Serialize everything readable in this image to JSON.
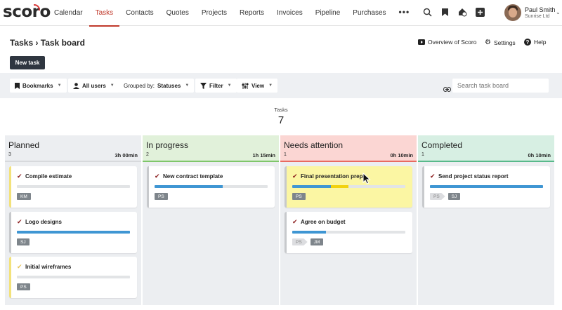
{
  "app": {
    "logo": "scoro",
    "nav": [
      "Calendar",
      "Tasks",
      "Contacts",
      "Quotes",
      "Projects",
      "Reports",
      "Invoices",
      "Pipeline",
      "Purchases"
    ],
    "nav_active": "Tasks",
    "more": "•••",
    "user": {
      "name": "Paul Smith",
      "company": "Sunrise Ltd"
    }
  },
  "header": {
    "breadcrumb": "Tasks › Task board",
    "overview_link": "Overview of Scoro",
    "settings_link": "Settings",
    "help_link": "Help",
    "new_task": "New task"
  },
  "toolbar": {
    "bookmarks": "Bookmarks",
    "users": "All users",
    "grouped_prefix": "Grouped by:",
    "grouped_value": "Statuses",
    "filter": "Filter",
    "view": "View",
    "search_placeholder": "Search task board"
  },
  "summary": {
    "label": "Tasks",
    "count": "7"
  },
  "columns": [
    {
      "title": "Planned",
      "count": "3",
      "time": "3h 00min",
      "head_color": "#eceef1",
      "underline": "#d7d9dc",
      "cards": [
        {
          "title": "Compile estimate",
          "check_color": "#8b1c1c",
          "accent": "#f3e27a",
          "bg": "#ffffff",
          "progress": [
            {
              "color": "#e2e4e6",
              "width": 0
            }
          ],
          "tags": [
            {
              "label": "KM",
              "ghost": false
            }
          ]
        },
        {
          "title": "Logo designs",
          "check_color": "#8b1c1c",
          "accent": "#c7c9cc",
          "bg": "#ffffff",
          "progress": [
            {
              "color": "#3f96d3",
              "width": 1.0
            }
          ],
          "tags": [
            {
              "label": "SJ",
              "ghost": false
            }
          ]
        },
        {
          "title": "Initial wireframes",
          "check_color": "#e6c35a",
          "accent": "#f3e27a",
          "bg": "#ffffff",
          "progress": [
            {
              "color": "#e2e4e6",
              "width": 0
            }
          ],
          "tags": [
            {
              "label": "PS",
              "ghost": false
            }
          ]
        }
      ]
    },
    {
      "title": "In progress",
      "count": "2",
      "time": "1h 15min",
      "head_color": "#e1f1da",
      "underline": "#7fc66a",
      "cards": [
        {
          "title": "New contract template",
          "check_color": "#8b1c1c",
          "accent": "#c7c9cc",
          "bg": "#ffffff",
          "progress": [
            {
              "color": "#3f96d3",
              "width": 0.6
            }
          ],
          "tags": [
            {
              "label": "PS",
              "ghost": false
            }
          ]
        }
      ]
    },
    {
      "title": "Needs attention",
      "count": "1",
      "time": "0h 10min",
      "head_color": "#fbd6d3",
      "underline": "#e86a60",
      "cards": [
        {
          "title": "Final presentation prep",
          "check_color": "#8b1c1c",
          "accent": "#c7c9cc",
          "bg": "#fbf6a3",
          "progress": [
            {
              "color": "#3f96d3",
              "width": 0.34
            },
            {
              "color": "#f2d20f",
              "width": 0.16
            }
          ],
          "tags": [
            {
              "label": "PS",
              "ghost": false
            }
          ]
        },
        {
          "title": "Agree on budget",
          "check_color": "#8b1c1c",
          "accent": "#c7c9cc",
          "bg": "#ffffff",
          "progress": [
            {
              "color": "#3f96d3",
              "width": 0.3
            }
          ],
          "tags": [
            {
              "label": "PS",
              "ghost": true
            },
            {
              "label": "JM",
              "ghost": false
            }
          ]
        }
      ]
    },
    {
      "title": "Completed",
      "count": "1",
      "time": "0h 10min",
      "head_color": "#d7efe3",
      "underline": "#58b98b",
      "cards": [
        {
          "title": "Send project status report",
          "check_color": "#8b1c1c",
          "accent": "#c7c9cc",
          "bg": "#ffffff",
          "progress": [
            {
              "color": "#3f96d3",
              "width": 1.0
            }
          ],
          "tags": [
            {
              "label": "PS",
              "ghost": true
            },
            {
              "label": "SJ",
              "ghost": false
            }
          ]
        }
      ]
    }
  ],
  "colors": {
    "brand": "#c0392b",
    "primary_button": "#2f3640",
    "progress_blue": "#3f96d3"
  }
}
